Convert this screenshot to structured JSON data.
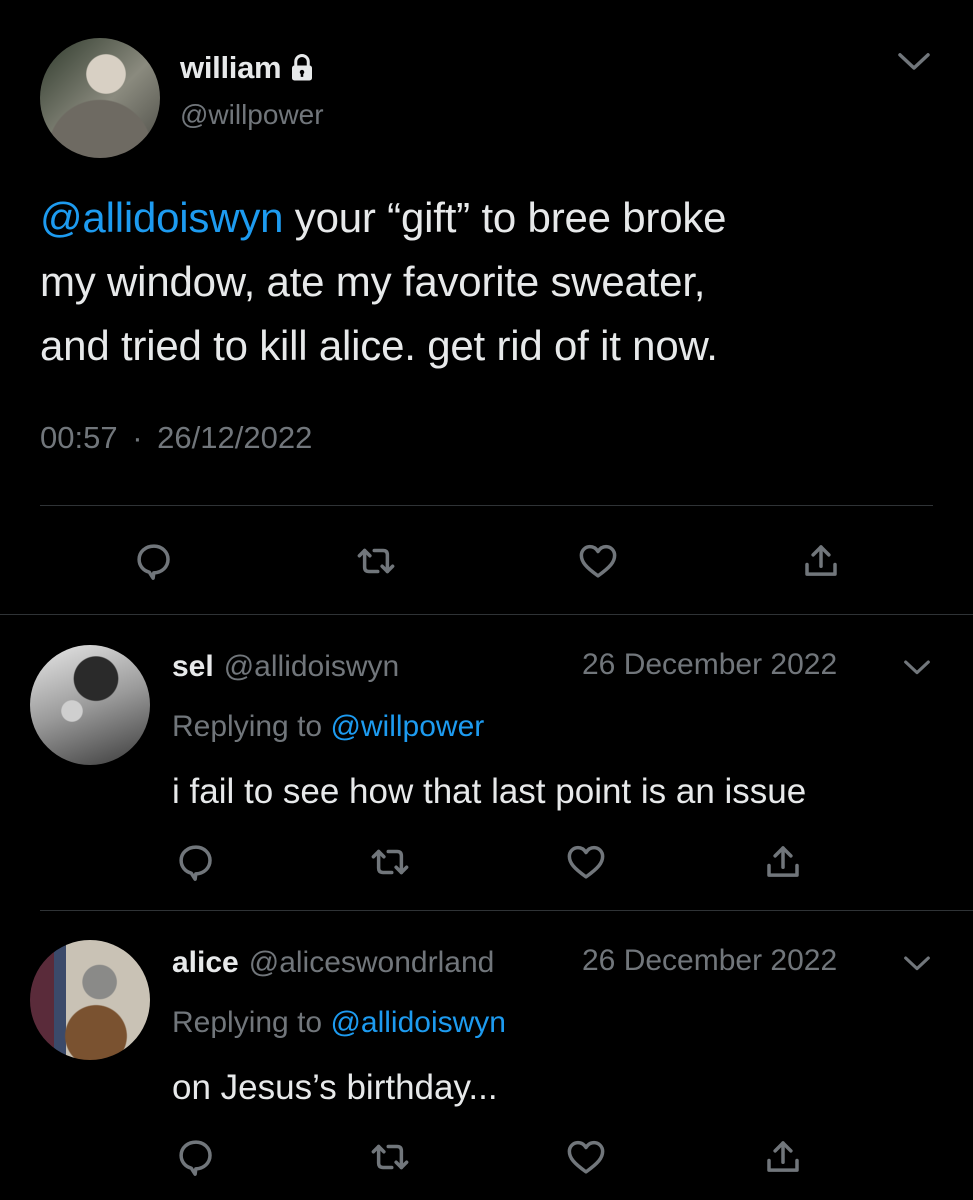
{
  "main_tweet": {
    "display_name": "william",
    "handle": "@willpower",
    "mention": "@allidoiswyn",
    "text_line1": " your “gift” to bree broke",
    "text_line2": "my window, ate my favorite sweater,",
    "text_line3": "and tried to kill alice. get rid of it now.",
    "time": "00:57",
    "separator": "·",
    "date": "26/12/2022"
  },
  "replies": [
    {
      "display_name": "sel",
      "handle": "@allidoiswyn",
      "date": "26 December 2022",
      "replying_prefix": "Replying to ",
      "replying_to": "@willpower",
      "text": "i fail to see how that last point is an issue"
    },
    {
      "display_name": "alice",
      "handle": "@aliceswondrland",
      "date": "26 December 2022",
      "replying_prefix": "Replying to ",
      "replying_to": "@allidoiswyn",
      "text": "on Jesus’s birthday..."
    }
  ],
  "icons": {
    "reply": "speech-bubble",
    "retweet": "retweet-arrows",
    "like": "heart-outline",
    "share": "share-arrow-up",
    "more": "chevron-down",
    "protected": "lock"
  },
  "colors": {
    "background": "#000000",
    "text": "#e7e9ea",
    "secondary": "#71767b",
    "link": "#1d9bf0",
    "divider": "#2f3336"
  }
}
